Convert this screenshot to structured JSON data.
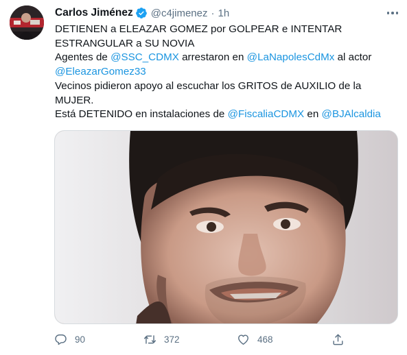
{
  "tweet": {
    "author_name": "Carlos Jiménez",
    "author_handle": "@c4jimenez",
    "separator": "·",
    "time": "1h",
    "body": {
      "line1": "DETIENEN a ELEAZAR GOMEZ por GOLPEAR e INTENTAR ESTRANGULAR a SU NOVIA",
      "agentes_prefix": "Agentes de ",
      "mention_ssc": "@SSC_CDMX",
      "arrestaron": " arrestaron en ",
      "mention_napoles": "@LaNapolesCdMx",
      "al_actor": " al actor",
      "mention_eleazar": "@EleazarGomez33",
      "vecinos": "Vecinos pidieron apoyo al escuchar los GRITOS de AUXILIO de la MUJER.",
      "esta_prefix": "Está DETENIDO en instalaciones de ",
      "mention_fiscalia": "@FiscaliaCDMX",
      "en": " en ",
      "mention_bj": "@BJAlcaldia"
    },
    "actions": {
      "reply_count": "90",
      "retweet_count": "372",
      "like_count": "468"
    }
  },
  "colors": {
    "link": "#1b95e0",
    "secondary_text": "#5b7083",
    "verified": "#1da1f2"
  },
  "icons": [
    "verified-badge-icon",
    "more-icon",
    "reply-icon",
    "retweet-icon",
    "like-icon",
    "share-icon"
  ]
}
